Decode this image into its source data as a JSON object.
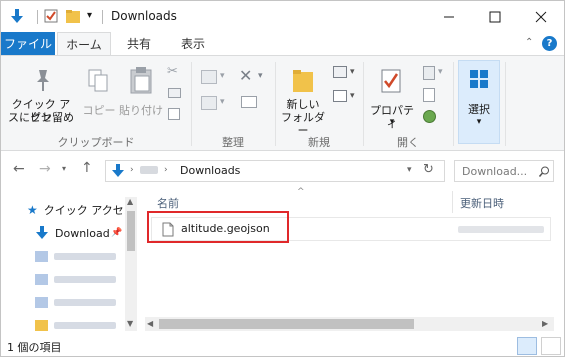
{
  "title": "Downloads",
  "ribbon_tabs": [
    "ファイル",
    "ホーム",
    "共有",
    "表示"
  ],
  "ribbon": {
    "pin_label_line1": "クイック アクセ",
    "pin_label_line2": "スにピン留め",
    "copy_label": "コピー",
    "paste_label": "貼り付け",
    "group_clipboard": "クリップボード",
    "group_organize": "整理",
    "new_folder_line1": "新しい",
    "new_folder_line2": "フォルダー",
    "group_new": "新規",
    "properties_label": "プロパティ",
    "group_open": "開く",
    "select_label": "選択"
  },
  "address": {
    "crumb_blurred": "PC",
    "current": "Downloads",
    "search_placeholder": "Download..."
  },
  "nav": {
    "quick_access": "クイック アクセス",
    "downloads": "Downloads"
  },
  "columns": {
    "name": "名前",
    "date": "更新日時"
  },
  "files": [
    {
      "name": "altitude.geojson",
      "date_blurred": "2016/06/06 15:07"
    }
  ],
  "status": {
    "item_count": "1 個の項目"
  },
  "colors": {
    "file_tab": "#1979ca",
    "highlight_box": "#e0282a",
    "accent_icon": "#1979ca",
    "folder": "#f1c24a"
  }
}
